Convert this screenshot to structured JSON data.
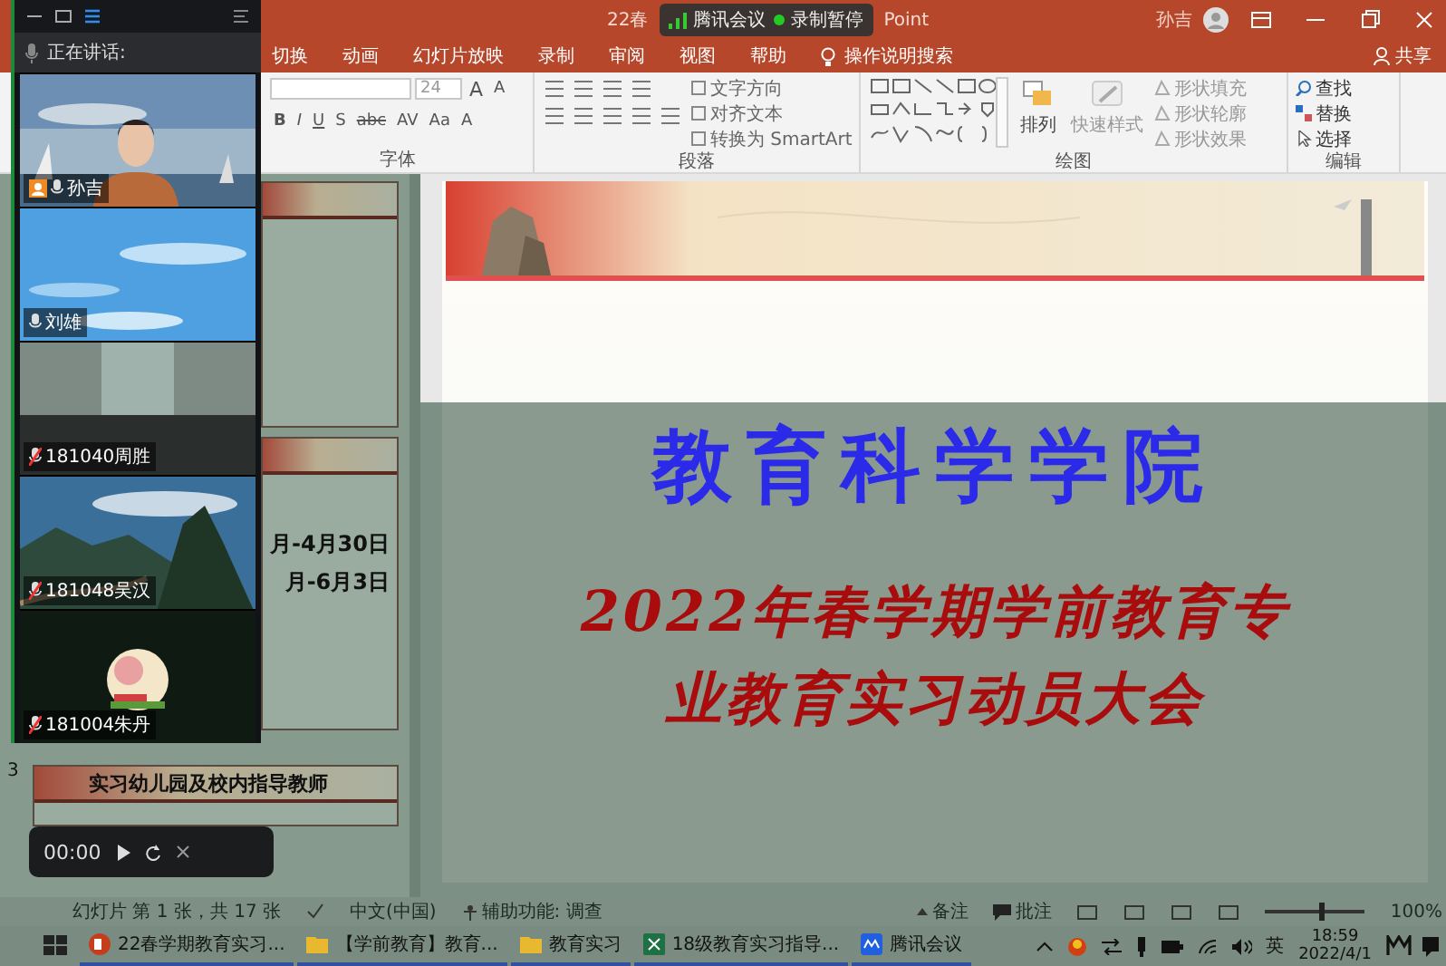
{
  "window": {
    "title_start": "22春",
    "title_end": "Point",
    "user": "孙吉",
    "share": "共享"
  },
  "meeting_badge": {
    "app": "腾讯会议",
    "recording": "录制暂停"
  },
  "ribbon_tabs": [
    "切换",
    "动画",
    "幻灯片放映",
    "录制",
    "审阅",
    "视图",
    "帮助"
  ],
  "search": {
    "placeholder": "操作说明搜索"
  },
  "font_group": {
    "font_size": "24",
    "label": "字体",
    "size_buttons": [
      "A",
      "A"
    ],
    "format_buttons": [
      "B",
      "I",
      "U",
      "S",
      "abc",
      "AV",
      "Aa",
      "A"
    ]
  },
  "paragraph_group": {
    "label": "段落",
    "commands": [
      "文字方向",
      "对齐文本",
      "转换为 SmartArt"
    ]
  },
  "drawing_group": {
    "label": "绘图",
    "arrange": "排列",
    "quick_styles": "快速样式",
    "shape_commands": [
      "形状填充",
      "形状轮廓",
      "形状效果"
    ]
  },
  "editing_group": {
    "label": "编辑",
    "commands": [
      "查找",
      "替换",
      "选择"
    ]
  },
  "meeting_panel": {
    "speaking": "正在讲话:",
    "tiles": [
      {
        "name": "孙吉",
        "kind": "camera",
        "muted": false,
        "host": true
      },
      {
        "name": "刘雄",
        "kind": "sky",
        "muted": false,
        "host": false
      },
      {
        "name": "181040周胜",
        "kind": "blank",
        "muted": true,
        "host": false
      },
      {
        "name": "181048吴汉",
        "kind": "landscape",
        "muted": true,
        "host": false
      },
      {
        "name": "181004朱丹",
        "kind": "avatar",
        "muted": true,
        "host": false
      }
    ]
  },
  "player": {
    "time": "00:00"
  },
  "thumbnails": [
    {
      "kind": "slide"
    },
    {
      "kind": "slide",
      "lines": [
        "月-4月30日",
        "月-6月3日"
      ]
    },
    {
      "kind": "slide",
      "number": "3",
      "title": "实习幼儿园及校内指导教师"
    }
  ],
  "slide": {
    "heading": "教育科学学院",
    "title_lines": [
      "2022年春学期学前教育专",
      "业教育实习动员大会"
    ]
  },
  "status_bar": {
    "slide_info": "幻灯片 第 1 张，共 17 张",
    "language": "中文(中国)",
    "accessibility": "辅助功能: 调查",
    "notes": "备注",
    "comments": "批注",
    "zoom": "100%",
    "zoom_slider": {
      "level": 0.55
    }
  },
  "taskbar": {
    "apps": [
      {
        "label": "22春学期教育实习...",
        "kind": "powerpoint"
      },
      {
        "label": "【学前教育】教育...",
        "kind": "folder"
      },
      {
        "label": "教育实习",
        "kind": "folder"
      },
      {
        "label": "18级教育实习指导...",
        "kind": "excel"
      },
      {
        "label": "腾讯会议",
        "kind": "meeting"
      }
    ],
    "ime": "英",
    "time": "18:59",
    "date": "2022/4/1"
  }
}
